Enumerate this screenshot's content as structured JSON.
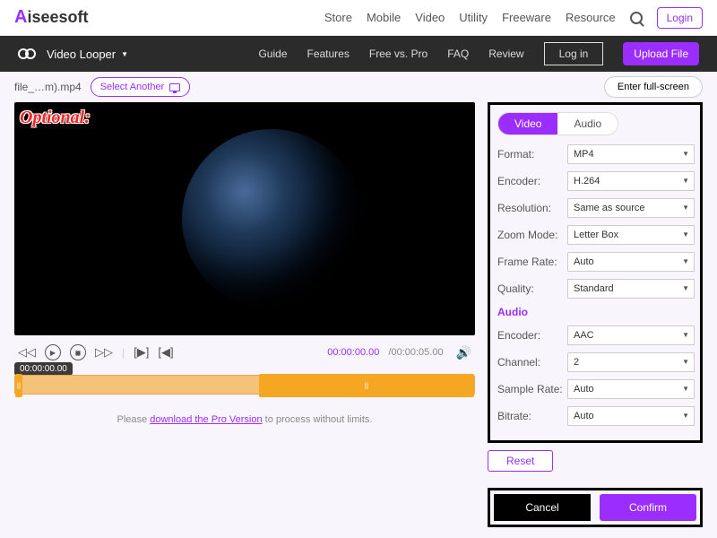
{
  "brand": {
    "prefix": "A",
    "rest": "iseesoft"
  },
  "topnav": [
    "Store",
    "Mobile",
    "Video",
    "Utility",
    "Freeware",
    "Resource"
  ],
  "login": "Login",
  "subnav": {
    "tool": "Video Looper",
    "links": [
      "Guide",
      "Features",
      "Free vs. Pro",
      "FAQ",
      "Review"
    ],
    "login": "Log in",
    "upload": "Upload File"
  },
  "filebar": {
    "name": "file_…m).mp4",
    "select_another": "Select Another",
    "fullscreen": "Enter full-screen"
  },
  "video": {
    "optional_label": "Optional:"
  },
  "player": {
    "time_current": "00:00:00.00",
    "time_total": "/00:00:05.00",
    "tag": "00:00:00.00"
  },
  "limits": {
    "pre": "Please ",
    "link": "download the Pro Version",
    "post": " to process without limits."
  },
  "tabs": {
    "video": "Video",
    "audio": "Audio"
  },
  "settings": {
    "format": {
      "label": "Format:",
      "value": "MP4"
    },
    "encoder": {
      "label": "Encoder:",
      "value": "H.264"
    },
    "resolution": {
      "label": "Resolution:",
      "value": "Same as source"
    },
    "zoom": {
      "label": "Zoom Mode:",
      "value": "Letter Box"
    },
    "framerate": {
      "label": "Frame Rate:",
      "value": "Auto"
    },
    "quality": {
      "label": "Quality:",
      "value": "Standard"
    }
  },
  "audio_header": "Audio",
  "audio": {
    "encoder": {
      "label": "Encoder:",
      "value": "AAC"
    },
    "channel": {
      "label": "Channel:",
      "value": "2"
    },
    "samplerate": {
      "label": "Sample Rate:",
      "value": "Auto"
    },
    "bitrate": {
      "label": "Bitrate:",
      "value": "Auto"
    }
  },
  "buttons": {
    "reset": "Reset",
    "cancel": "Cancel",
    "confirm": "Confirm"
  }
}
